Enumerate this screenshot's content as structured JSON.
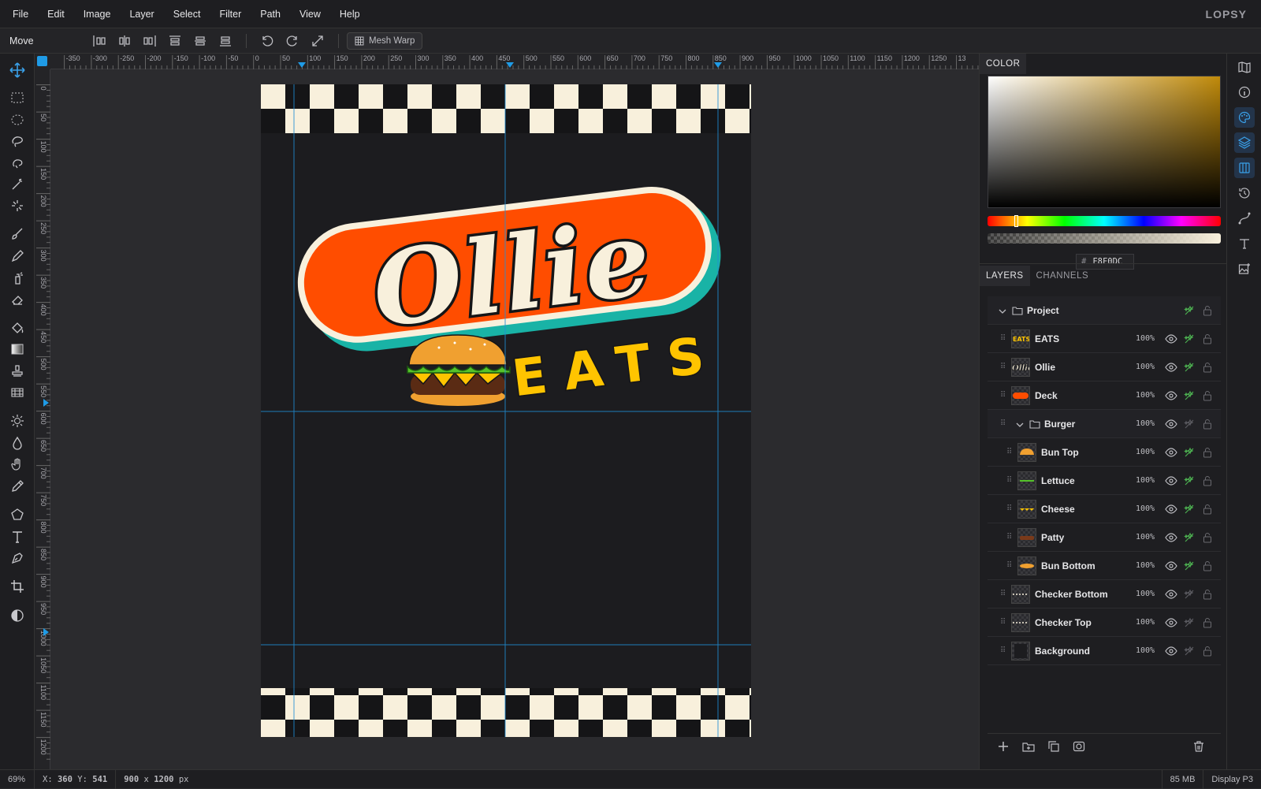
{
  "app": {
    "brand": "LOPSY"
  },
  "menu": [
    "File",
    "Edit",
    "Image",
    "Layer",
    "Select",
    "Filter",
    "Path",
    "View",
    "Help"
  ],
  "options": {
    "tool_name": "Move",
    "mesh_warp_label": "Mesh Warp"
  },
  "rulers": {
    "h_labels": [
      "-350",
      "-300",
      "-250",
      "-200",
      "-150",
      "-100",
      "-50",
      "0",
      "50",
      "100",
      "150",
      "200",
      "250",
      "300",
      "350",
      "400",
      "450",
      "500",
      "550",
      "600",
      "650",
      "700",
      "750",
      "800",
      "850",
      "900",
      "950",
      "1000",
      "1050",
      "1100",
      "1150",
      "1200",
      "1250",
      "13"
    ],
    "v_labels": [
      "0",
      "50",
      "100",
      "150",
      "200",
      "250",
      "300",
      "350",
      "400",
      "450",
      "500",
      "550",
      "600",
      "650",
      "700",
      "750",
      "800",
      "850",
      "900",
      "950",
      "1000",
      "1050",
      "1100",
      "1150",
      "1200"
    ]
  },
  "artwork": {
    "title_text": "Ollie",
    "sub_text": "EATS"
  },
  "color_panel": {
    "tab": "COLOR",
    "hex_prefix": "#",
    "hex": "F8F0DC",
    "hue_position": 0.12,
    "alpha": 1.0
  },
  "layers_panel": {
    "tabs": [
      "LAYERS",
      "CHANNELS"
    ],
    "rows": [
      {
        "name": "Project",
        "opacity": "",
        "indent": 0,
        "group": true,
        "fx": true
      },
      {
        "name": "EATS",
        "opacity": "100%",
        "indent": 1,
        "group": false,
        "fx": true,
        "thumb": "eats"
      },
      {
        "name": "Ollie",
        "opacity": "100%",
        "indent": 1,
        "group": false,
        "fx": true,
        "thumb": "ollie"
      },
      {
        "name": "Deck",
        "opacity": "100%",
        "indent": 1,
        "group": false,
        "fx": true,
        "thumb": "deck"
      },
      {
        "name": "Burger",
        "opacity": "100%",
        "indent": 1,
        "group": true,
        "fx": false
      },
      {
        "name": "Bun Top",
        "opacity": "100%",
        "indent": 2,
        "group": false,
        "fx": true,
        "thumb": "buntop"
      },
      {
        "name": "Lettuce",
        "opacity": "100%",
        "indent": 2,
        "group": false,
        "fx": true,
        "thumb": "lettuce"
      },
      {
        "name": "Cheese",
        "opacity": "100%",
        "indent": 2,
        "group": false,
        "fx": true,
        "thumb": "cheese"
      },
      {
        "name": "Patty",
        "opacity": "100%",
        "indent": 2,
        "group": false,
        "fx": true,
        "thumb": "patty"
      },
      {
        "name": "Bun Bottom",
        "opacity": "100%",
        "indent": 2,
        "group": false,
        "fx": true,
        "thumb": "bunbottom"
      },
      {
        "name": "Checker Bottom",
        "opacity": "100%",
        "indent": 1,
        "group": false,
        "fx": false,
        "thumb": "checker"
      },
      {
        "name": "Checker Top",
        "opacity": "100%",
        "indent": 1,
        "group": false,
        "fx": false,
        "thumb": "checker"
      },
      {
        "name": "Background",
        "opacity": "100%",
        "indent": 1,
        "group": false,
        "fx": false,
        "thumb": "bg"
      }
    ]
  },
  "status": {
    "zoom": "69%",
    "x_label": "X:",
    "x": "360",
    "y_label": "Y:",
    "y": "541",
    "doc_w": "900",
    "times": "x",
    "doc_h": "1200",
    "unit": "px",
    "memory": "85 MB",
    "profile": "Display P3"
  },
  "colors": {
    "accent": "#1f9be6",
    "deck": "#ff4d00",
    "teal": "#19b3a6",
    "cream": "#f8f0dc",
    "eats": "#ffc400",
    "fx_green": "#4caf50"
  }
}
